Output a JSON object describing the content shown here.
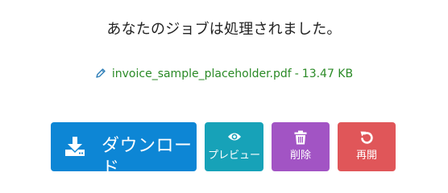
{
  "status_message": "あなたのジョブは処理されました。",
  "file": {
    "name": "invoice_sample_placeholder.pdf",
    "separator": "-",
    "size": "13.47 KB",
    "icon": "pencil-icon",
    "color": "#2a8a26"
  },
  "actions": {
    "download": {
      "label": "ダウンロード",
      "icon": "download-icon",
      "color": "#0d86d5"
    },
    "preview": {
      "label": "プレビュー",
      "icon": "eye-icon",
      "color": "#17a2b8"
    },
    "delete": {
      "label": "削除",
      "icon": "trash-icon",
      "color": "#a254c4"
    },
    "retry": {
      "label": "再開",
      "icon": "undo-icon",
      "color": "#e05659"
    }
  }
}
